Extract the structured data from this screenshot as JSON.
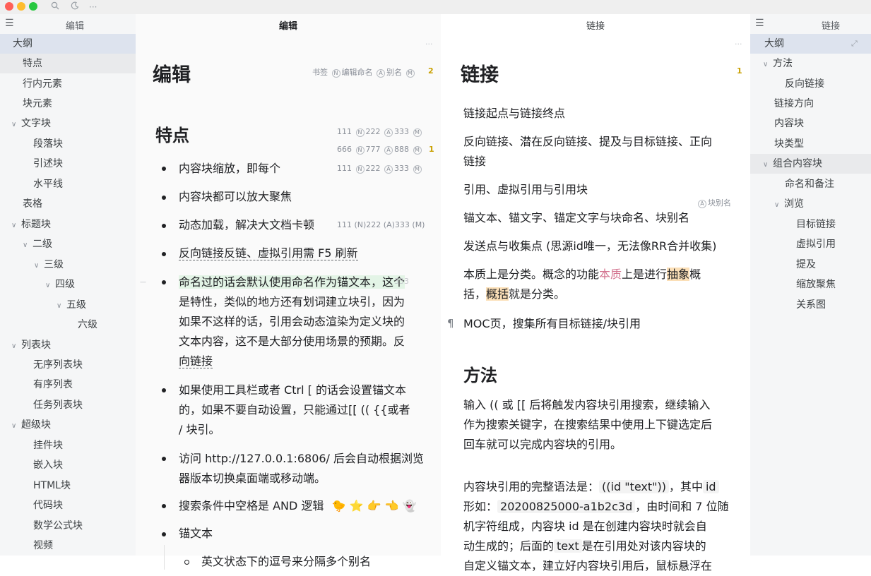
{
  "window": {
    "colors": {
      "red": "#ff5f57",
      "yellow": "#febc2e",
      "green": "#28c840"
    },
    "toolbar_icons": [
      "search-icon",
      "moon-icon",
      "more-icon"
    ]
  },
  "left_panel": {
    "title": "编辑",
    "items": [
      {
        "label": "大纲"
      },
      {
        "label": "特点"
      },
      {
        "label": "行内元素"
      },
      {
        "label": "块元素"
      },
      {
        "label": "文字块"
      },
      {
        "label": "段落块"
      },
      {
        "label": "引述块"
      },
      {
        "label": "水平线"
      },
      {
        "label": "表格"
      },
      {
        "label": "标题块"
      },
      {
        "label": "二级"
      },
      {
        "label": "三级"
      },
      {
        "label": "四级"
      },
      {
        "label": "五级"
      },
      {
        "label": "六级"
      },
      {
        "label": "列表块"
      },
      {
        "label": "无序列表块"
      },
      {
        "label": "有序列表"
      },
      {
        "label": "任务列表块"
      },
      {
        "label": "超级块"
      },
      {
        "label": "挂件块"
      },
      {
        "label": "嵌入块"
      },
      {
        "label": "HTML块"
      },
      {
        "label": "代码块"
      },
      {
        "label": "数学公式块"
      },
      {
        "label": "视频"
      }
    ]
  },
  "doc_a": {
    "tab": "编辑",
    "title": "编辑",
    "title_attrs": {
      "bookmark": "书签",
      "name": "编辑命名",
      "alias": "别名",
      "count": "2"
    },
    "h2": "特点",
    "h2_attrs": [
      {
        "n": "111",
        "name": "222",
        "alias": "333"
      },
      {
        "n": "666",
        "name": "777",
        "alias": "888",
        "count": "1"
      },
      {
        "n": "111",
        "name": "222",
        "alias": "333"
      }
    ],
    "bullets": [
      {
        "text": "内容块缩放，即每个"
      },
      {
        "text": "内容块都可以放大聚焦"
      },
      {
        "text": "动态加载，解决大文档卡顿",
        "attr": "111 (N)222 (A)333 (M)"
      },
      {
        "text": "反向链接反链、虚拟引用需 F5 刷新"
      },
      {
        "lines": [
          "命名过的话会默认使用命名作为锚文本，这个",
          "是特性，类似的地方还有划词建立块引，因为",
          "如果不这样的话，引用会动态渲染为定义块的",
          "文本内容，这不是大部分使用场景的预期。反",
          "向链接"
        ]
      },
      {
        "lines": [
          "如果使用工具栏或者 Ctrl [ 的话会设置锚文本",
          "的，如果不要自动设置，只能通过[[ (( {{或者",
          "/ 块引。"
        ]
      },
      {
        "lines": [
          "访问 http://127.0.0.1:6806/ 后会自动根据浏览",
          "器版本切换桌面端或移动端。"
        ]
      },
      {
        "text": "搜索条件中空格是 AND 逻辑"
      },
      {
        "text": "锚文本"
      }
    ],
    "sub_bullet": "英文状态下的逗号来分隔多个别名",
    "hidden_attr": "333"
  },
  "doc_b": {
    "tab": "链接",
    "title": "链接",
    "title_count": "1",
    "paras": [
      "链接起点与链接终点",
      "反向链接、潜在反向链接、提及与目标链接、正向",
      "链接",
      "引用、虚拟引用与引用块",
      "锚文本、锚文字、锚定文字与块命名、块别名",
      "发送点与收集点 (思源id唯一，无法像RR合并收集)",
      "MOC页，搜集所有目标链接/块引用"
    ],
    "alias_tag": "块别名",
    "essence": {
      "l1a": "本质上是分类。概念的功能",
      "pink": "本质",
      "l1b": "上是进行",
      "hl1": "抽象",
      "l1c": "概",
      "l2a": "括，",
      "hl2": "概括",
      "l2b": "就是分类。"
    },
    "h2": "方法",
    "method_lines": [
      "输入 (( 或 [[ 后将触发内容块引用搜索，继续输入",
      "作为搜索关键字，在搜索结果中使用上下键选定后",
      "回车就可以完成内容块的引用。"
    ],
    "syntax": {
      "l1a": "内容块引用的完整语法是：",
      "code1": "((id \"text\"))",
      "l1b": "，其中",
      "code2": "id",
      "l2a": "形如：",
      "code3": "20200825000-a1b2c3d",
      "l2b": "，由时间和 7 位随",
      "l3": "机字符组成，内容块 id 是在创建内容块时就会自",
      "l4a": "动生成的；后面的",
      "code4": "text",
      "l4b": "是在引用处对该内容块的",
      "l5": "自定义锚文本，建立好内容块引用后，鼠标悬浮在"
    }
  },
  "right_panel": {
    "title": "链接",
    "items": [
      {
        "label": "大纲"
      },
      {
        "label": "方法"
      },
      {
        "label": "反向链接"
      },
      {
        "label": "链接方向"
      },
      {
        "label": "内容块"
      },
      {
        "label": "块类型"
      },
      {
        "label": "组合内容块"
      },
      {
        "label": "命名和备注"
      },
      {
        "label": "浏览"
      },
      {
        "label": "目标链接"
      },
      {
        "label": "虚拟引用"
      },
      {
        "label": "提及"
      },
      {
        "label": "缩放聚焦"
      },
      {
        "label": "关系图"
      }
    ]
  }
}
